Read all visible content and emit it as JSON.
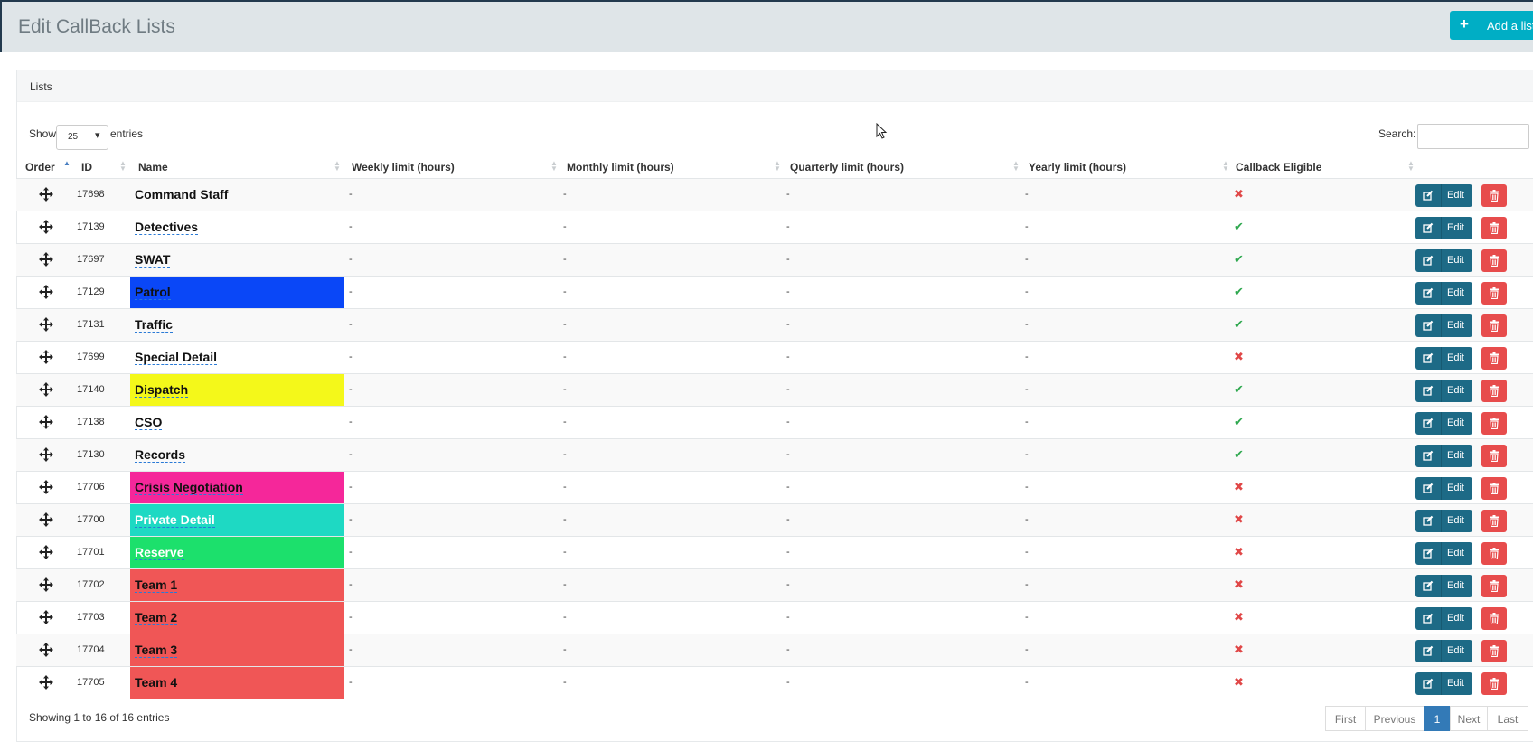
{
  "header": {
    "title": "Edit CallBack Lists",
    "add_label": "Add a list"
  },
  "panel": {
    "title": "Lists"
  },
  "length": {
    "show_label": "Show",
    "value": "25",
    "entries_label": "entries"
  },
  "search": {
    "label": "Search:",
    "value": ""
  },
  "columns": [
    "Order",
    "ID",
    "Name",
    "Weekly limit (hours)",
    "Monthly limit (hours)",
    "Quarterly limit (hours)",
    "Yearly limit (hours)",
    "Callback Eligible"
  ],
  "edit_label": "Edit",
  "rows": [
    {
      "id": "17698",
      "name": "Command Staff",
      "color": "",
      "weekly": "-",
      "monthly": "-",
      "quarterly": "-",
      "yearly": "-",
      "eligible": false
    },
    {
      "id": "17139",
      "name": "Detectives",
      "color": "",
      "weekly": "-",
      "monthly": "-",
      "quarterly": "-",
      "yearly": "-",
      "eligible": true
    },
    {
      "id": "17697",
      "name": "SWAT",
      "color": "",
      "weekly": "-",
      "monthly": "-",
      "quarterly": "-",
      "yearly": "-",
      "eligible": true
    },
    {
      "id": "17129",
      "name": "Patrol",
      "color": "#0a47f7",
      "weekly": "-",
      "monthly": "-",
      "quarterly": "-",
      "yearly": "-",
      "eligible": true
    },
    {
      "id": "17131",
      "name": "Traffic",
      "color": "",
      "weekly": "-",
      "monthly": "-",
      "quarterly": "-",
      "yearly": "-",
      "eligible": true
    },
    {
      "id": "17699",
      "name": "Special Detail",
      "color": "",
      "weekly": "-",
      "monthly": "-",
      "quarterly": "-",
      "yearly": "-",
      "eligible": false
    },
    {
      "id": "17140",
      "name": "Dispatch",
      "color": "#f4f81a",
      "weekly": "-",
      "monthly": "-",
      "quarterly": "-",
      "yearly": "-",
      "eligible": true
    },
    {
      "id": "17138",
      "name": "CSO",
      "color": "",
      "weekly": "-",
      "monthly": "-",
      "quarterly": "-",
      "yearly": "-",
      "eligible": true
    },
    {
      "id": "17130",
      "name": "Records",
      "color": "",
      "weekly": "-",
      "monthly": "-",
      "quarterly": "-",
      "yearly": "-",
      "eligible": true
    },
    {
      "id": "17706",
      "name": "Crisis Negotiation",
      "color": "#f5279a",
      "weekly": "-",
      "monthly": "-",
      "quarterly": "-",
      "yearly": "-",
      "eligible": false
    },
    {
      "id": "17700",
      "name": "Private Detail",
      "color": "#1ed9c3",
      "light": true,
      "weekly": "-",
      "monthly": "-",
      "quarterly": "-",
      "yearly": "-",
      "eligible": false
    },
    {
      "id": "17701",
      "name": "Reserve",
      "color": "#1ce06c",
      "light": true,
      "weekly": "-",
      "monthly": "-",
      "quarterly": "-",
      "yearly": "-",
      "eligible": false
    },
    {
      "id": "17702",
      "name": "Team 1",
      "color": "#f05656",
      "weekly": "-",
      "monthly": "-",
      "quarterly": "-",
      "yearly": "-",
      "eligible": false
    },
    {
      "id": "17703",
      "name": "Team 2",
      "color": "#f05656",
      "weekly": "-",
      "monthly": "-",
      "quarterly": "-",
      "yearly": "-",
      "eligible": false
    },
    {
      "id": "17704",
      "name": "Team 3",
      "color": "#f05656",
      "weekly": "-",
      "monthly": "-",
      "quarterly": "-",
      "yearly": "-",
      "eligible": false
    },
    {
      "id": "17705",
      "name": "Team 4",
      "color": "#f05656",
      "weekly": "-",
      "monthly": "-",
      "quarterly": "-",
      "yearly": "-",
      "eligible": false
    }
  ],
  "footer": {
    "info": "Showing 1 to 16 of 16 entries"
  },
  "pagination": [
    "First",
    "Previous",
    "1",
    "Next",
    "Last"
  ],
  "colors": {
    "topbar": "#dfe5e8",
    "add_button": "#00aec5",
    "edit_button": "#1d6a86",
    "delete_button": "#e74c4c",
    "active_page": "#337ab7",
    "eligible_yes": "#2fa84f",
    "eligible_no": "#e04747"
  }
}
